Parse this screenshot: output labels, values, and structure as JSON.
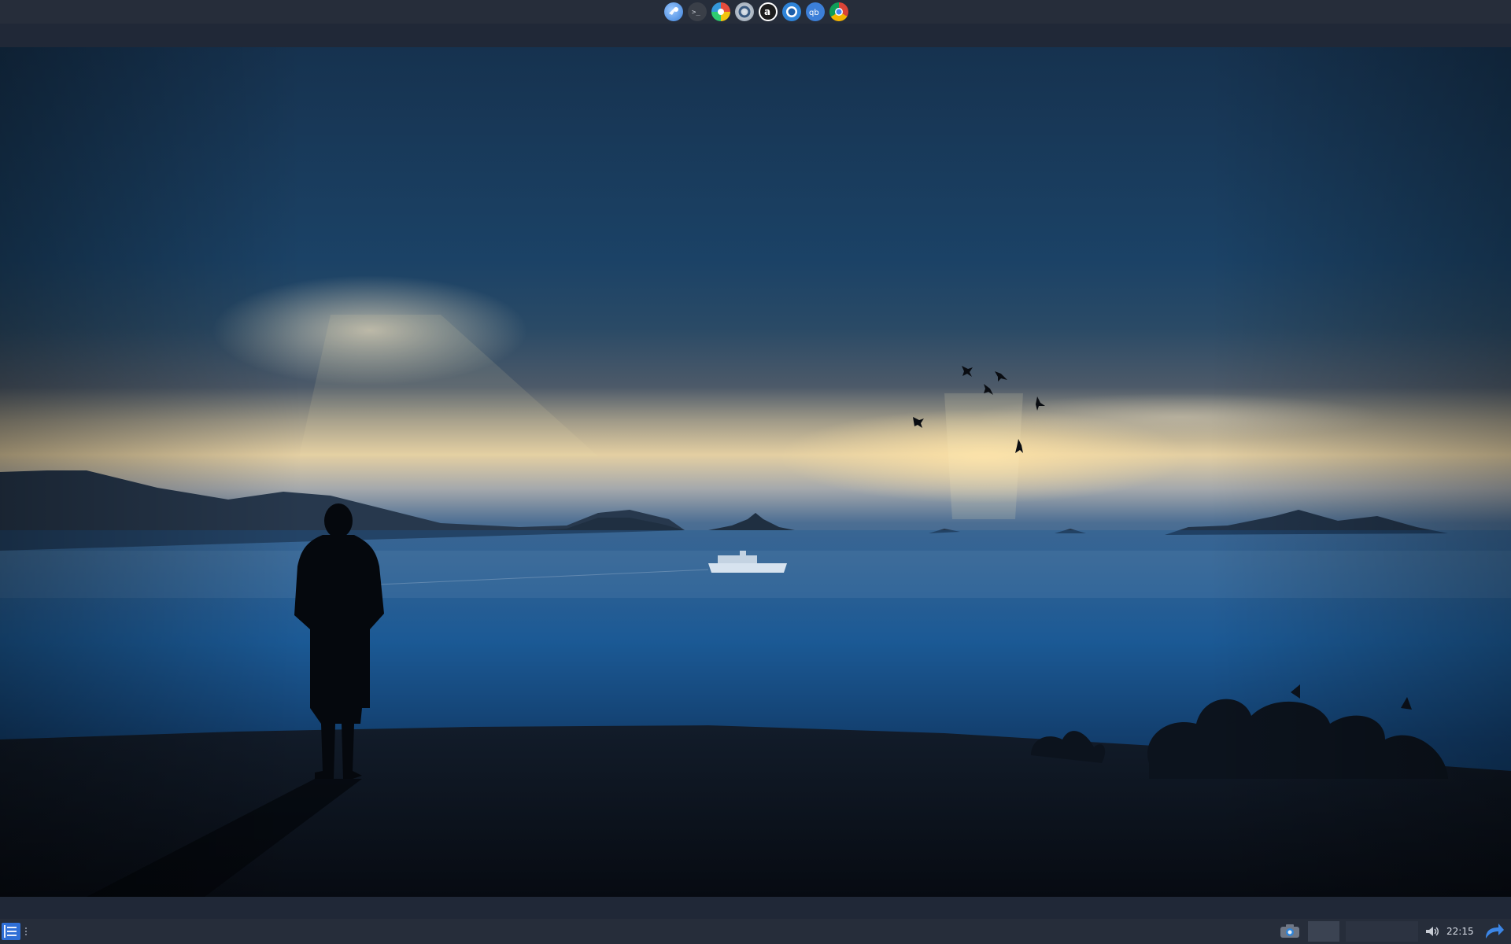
{
  "top_dock": {
    "apps": [
      {
        "name": "settings-app-icon"
      },
      {
        "name": "terminal-app-icon"
      },
      {
        "name": "color-picker-app-icon"
      },
      {
        "name": "software-center-app-icon"
      },
      {
        "name": "amazon-app-icon"
      },
      {
        "name": "screen-recorder-app-icon"
      },
      {
        "name": "qbittorrent-app-icon"
      },
      {
        "name": "chrome-app-icon"
      }
    ]
  },
  "wallpaper": {
    "scene": "silhouette-overlooking-sea"
  },
  "bottom_panel": {
    "clock": "22:15",
    "icons": [
      "menu-icon",
      "camera-icon",
      "volume-icon",
      "updates-icon"
    ]
  },
  "colors": {
    "panel": "#262d3a",
    "accent": "#2f6fd6"
  }
}
